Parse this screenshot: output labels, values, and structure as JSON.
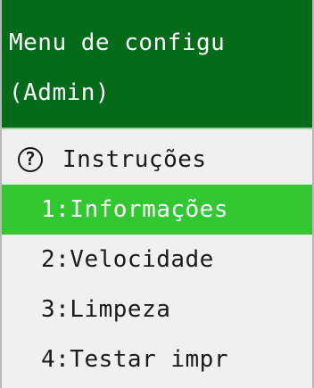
{
  "header": {
    "title_line1": "Menu de configu",
    "title_line2": "(Admin)"
  },
  "menu": {
    "help_icon_glyph": "?",
    "help_label": "Instruções",
    "items": [
      {
        "label": "1:Informações",
        "selected": true
      },
      {
        "label": "2:Velocidade",
        "selected": false
      },
      {
        "label": "3:Limpeza",
        "selected": false
      },
      {
        "label": "4:Testar impr",
        "selected": false
      }
    ]
  },
  "colors": {
    "header_bg": "#056b1b",
    "selected_bg": "#33c831",
    "panel_bg": "#f0f0f0"
  }
}
